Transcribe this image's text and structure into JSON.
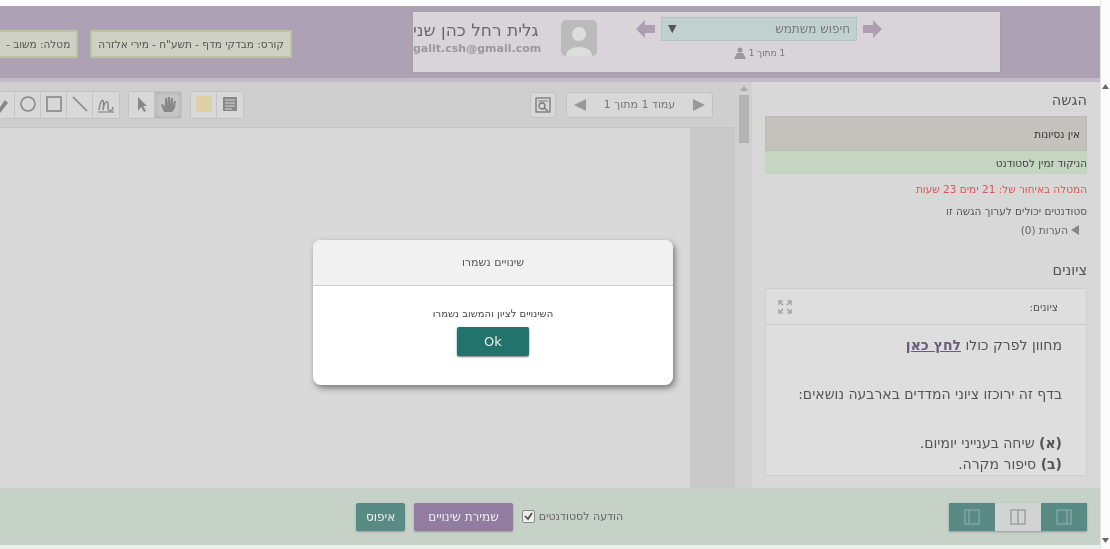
{
  "header": {
    "user": {
      "name": "גלית רחל כהן שני",
      "email": "galit.csh@gmail.com"
    },
    "search": {
      "placeholder": "חיפוש משתמש",
      "caret": "▼"
    },
    "counter": "1 מתוך 1",
    "tags": [
      "קורס: מבדקי מדף - תשע\"ח - מירי אלזרה",
      "מטלה: משוב -"
    ]
  },
  "toolbar": {
    "tools": [
      {
        "kind": "pen",
        "selected": false
      },
      {
        "kind": "circle",
        "selected": false
      },
      {
        "kind": "square",
        "selected": false
      },
      {
        "kind": "line",
        "selected": false
      },
      {
        "kind": "freehand",
        "selected": false
      },
      {
        "kind": "pointer",
        "selected": false
      },
      {
        "kind": "hand",
        "selected": true
      },
      {
        "kind": "color",
        "selected": false
      },
      {
        "kind": "text",
        "selected": false
      }
    ],
    "pager": "עמוד 1 מתוך 1"
  },
  "submission": {
    "title": "הגשה",
    "attempts": "אין נסיונות",
    "released": "הניקוד זמין לסטודנט",
    "late": "המטלה באיחור של: 21 ימים 23 שעות",
    "editable": "סטודנטים יכולים לערוך הגשה זו",
    "comments": {
      "label": "הערות (0)",
      "expanded": false
    }
  },
  "grades": {
    "title": "ציונים",
    "editor_label": "ציונים:",
    "rubric": {
      "text": "מחוון לפרק כולו",
      "link": "לחץ כאן"
    },
    "paragraphs": [
      "בדף זה ירוכזו ציוני המדדים בארבעה נושאים:",
      "**(א)** שיחה בענייני יומיום.",
      "**(ב)** סיפור מקרה."
    ]
  },
  "footer": {
    "notify": {
      "label": "הודעה לסטודנטים",
      "checked": true
    },
    "buttons": [
      {
        "label": "שמירת שינויים",
        "kind": "save"
      },
      {
        "label": "איפוס",
        "kind": "reset"
      }
    ],
    "layouts": [
      {
        "kind": "left",
        "selected": false
      },
      {
        "kind": "split",
        "selected": true
      },
      {
        "kind": "right",
        "selected": false
      }
    ]
  },
  "dialog": {
    "title": "שינויים נשמרו",
    "message": "השינויים לציון והמשוב נשמרו",
    "button": "Ok"
  }
}
